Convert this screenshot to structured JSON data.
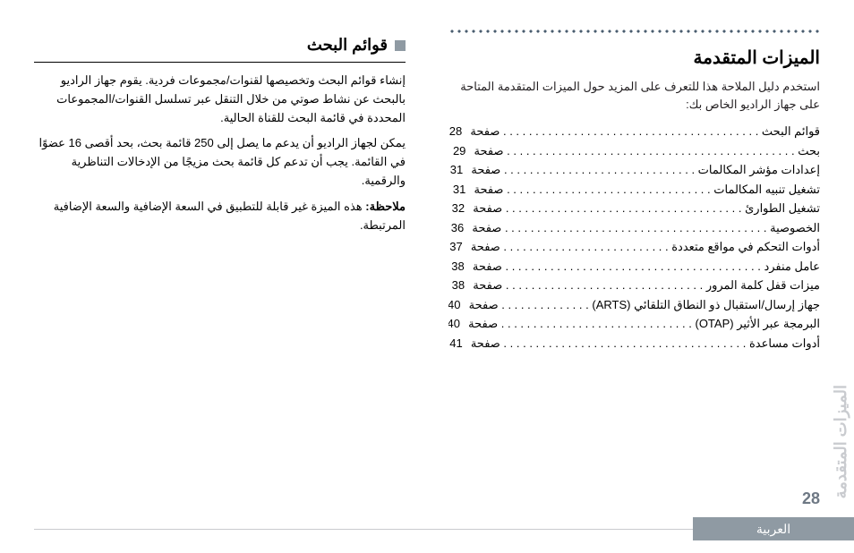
{
  "right": {
    "title": "الميزات المتقدمة",
    "intro": "استخدم دليل الملاحة هذا للتعرف على المزيد حول الميزات المتقدمة المتاحة على جهاز الراديو الخاص بك:",
    "page_word": "صفحة",
    "toc": [
      {
        "label": "قوائم البحث",
        "page": "28"
      },
      {
        "label": "بحث",
        "page": "29"
      },
      {
        "label": "إعدادات مؤشر المكالمات",
        "page": "31"
      },
      {
        "label": "تشغيل تنبيه المكالمات",
        "page": "31"
      },
      {
        "label": "تشغيل الطوارئ",
        "page": "32"
      },
      {
        "label": "الخصوصية",
        "page": "36"
      },
      {
        "label": "أدوات التحكم في مواقع متعددة",
        "page": "37"
      },
      {
        "label": "عامل منفرد",
        "page": "38"
      },
      {
        "label": "ميزات قفل كلمة المرور",
        "page": "38"
      },
      {
        "label": "جهاز إرسال/استقبال ذو النطاق التلقائي (ARTS)",
        "page": "40"
      },
      {
        "label": "البرمجة عبر الأثير (OTAP)",
        "page": "40"
      },
      {
        "label": "أدوات مساعدة",
        "page": "41"
      }
    ]
  },
  "left": {
    "heading": "قوائم البحث",
    "p1": "إنشاء قوائم البحث وتخصيصها لقنوات/مجموعات فردية. يقوم جهاز الراديو بالبحث عن نشاط صوتي من خلال التنقل عبر تسلسل القنوات/المجموعات المحددة في قائمة البحث للقناة الحالية.",
    "p2": "يمكن لجهاز الراديو أن يدعم ما يصل إلى 250 قائمة بحث، بحد أقصى 16 عضوًا في القائمة. يجب أن تدعم كل قائمة بحث مزيجًا من الإدخالات التناظرية والرقمية.",
    "note_label": "ملاحظة:",
    "note_text": "هذه الميزة غير قابلة للتطبيق في السعة الإضافية والسعة الإضافية المرتبطة."
  },
  "side_tab": "الميزات المتقدمة",
  "page_number": "28",
  "lang": "العربية"
}
